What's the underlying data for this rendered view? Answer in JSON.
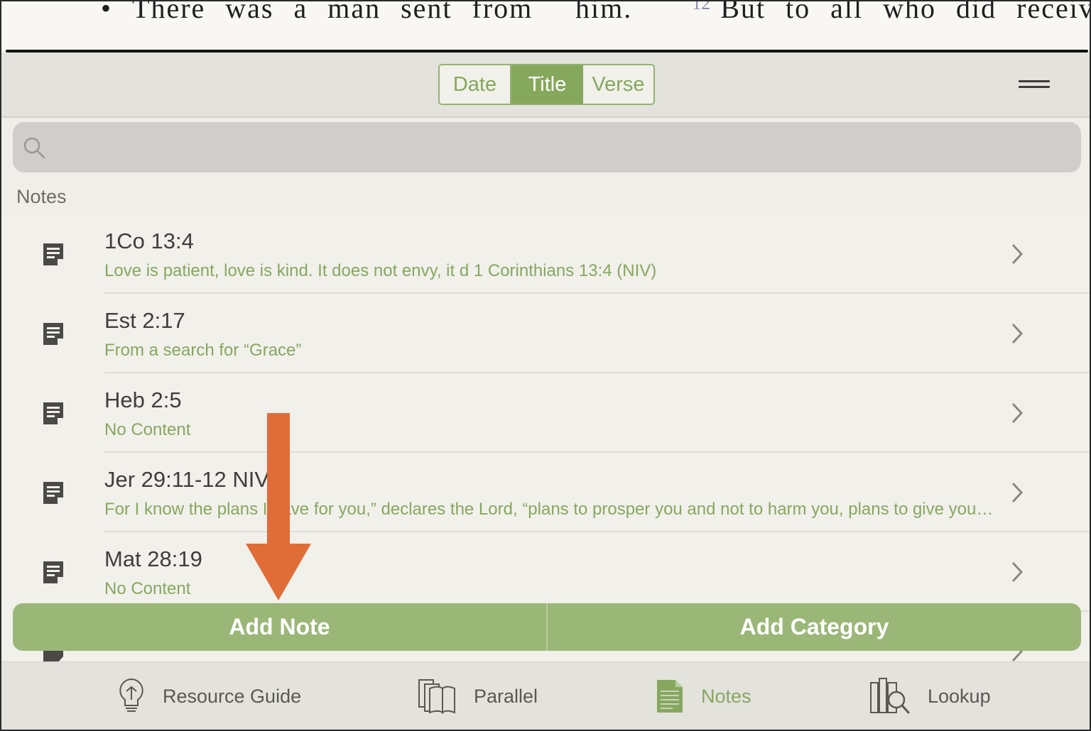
{
  "reader": {
    "left_text": "There  was  a  man  sent  from",
    "right_text": "him.",
    "verse_number": "12",
    "right_text_after": "But  to  all  who  did  receive"
  },
  "header": {
    "sort_options": [
      "Date",
      "Title",
      "Verse"
    ],
    "selected_sort": "Title"
  },
  "search": {
    "placeholder": "",
    "value": ""
  },
  "section_label": "Notes",
  "notes": [
    {
      "title": "1Co 13:4",
      "subtitle": "Love is patient, love is kind. It does not envy, it d 1 Corinthians 13:4 (NIV)"
    },
    {
      "title": "Est 2:17",
      "subtitle": "From a search for “Grace”"
    },
    {
      "title": "Heb 2:5",
      "subtitle": "No Content"
    },
    {
      "title": "Jer 29:11-12 NIV",
      "subtitle": "For I know the plans I have for you,” declares the Lord, “plans to prosper you and not to harm you, plans to give you hope and a future."
    },
    {
      "title": "Mat 28:19",
      "subtitle": "No Content"
    }
  ],
  "actions": {
    "add_note": "Add Note",
    "add_category": "Add Category"
  },
  "tabs": [
    {
      "label": "Resource Guide",
      "icon": "lightbulb-icon"
    },
    {
      "label": "Parallel",
      "icon": "books-icon"
    },
    {
      "label": "Notes",
      "icon": "notes-document-icon",
      "active": true
    },
    {
      "label": "Lookup",
      "icon": "library-search-icon"
    }
  ],
  "colors": {
    "accent": "#87a760",
    "annotation_arrow": "#e06c37"
  }
}
